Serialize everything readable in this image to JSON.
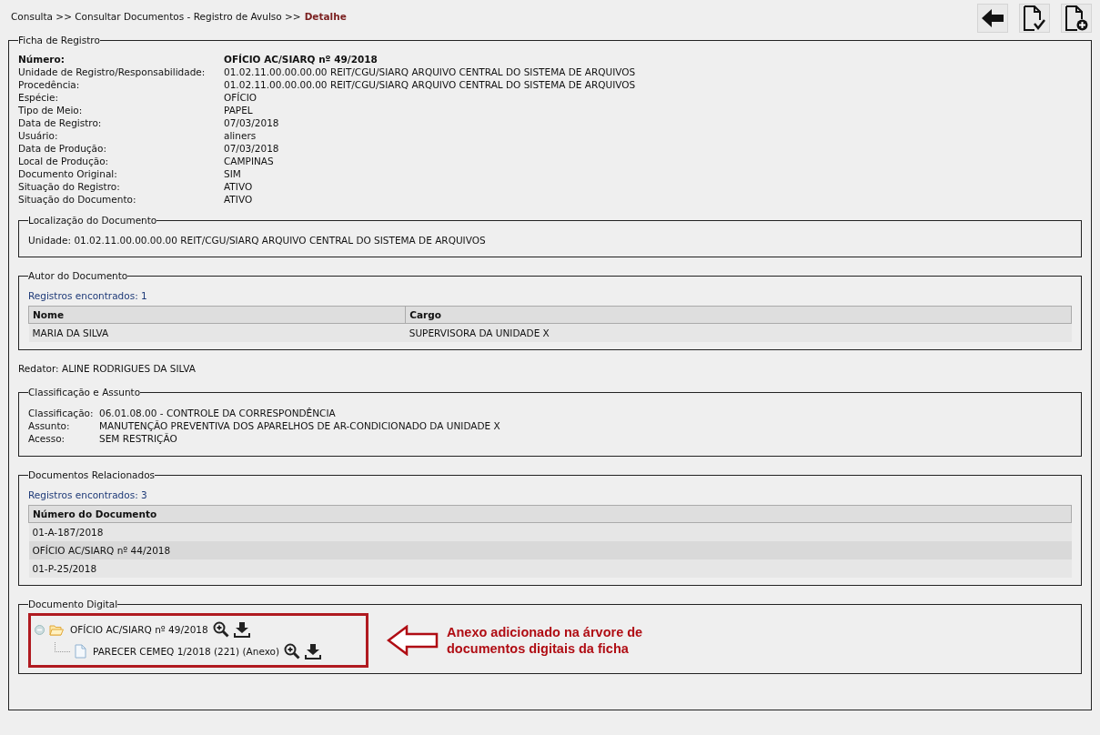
{
  "breadcrumb": {
    "path": "Consulta >> Consultar Documentos - Registro de Avulso >>",
    "current": "Detalhe"
  },
  "ficha": {
    "legend": "Ficha de Registro",
    "fields": [
      {
        "label": "Número:",
        "value": "OFÍCIO AC/SIARQ nº 49/2018",
        "bold": true
      },
      {
        "label": "Unidade de Registro/Responsabilidade:",
        "value": "01.02.11.00.00.00.00 REIT/CGU/SIARQ ARQUIVO CENTRAL DO SISTEMA DE ARQUIVOS",
        "bold": false
      },
      {
        "label": "Procedência:",
        "value": "01.02.11.00.00.00.00 REIT/CGU/SIARQ ARQUIVO CENTRAL DO SISTEMA DE ARQUIVOS",
        "bold": false
      },
      {
        "label": "Espécie:",
        "value": "OFÍCIO",
        "bold": false
      },
      {
        "label": "Tipo de Meio:",
        "value": "PAPEL",
        "bold": false
      },
      {
        "label": "Data de Registro:",
        "value": "07/03/2018",
        "bold": false
      },
      {
        "label": "Usuário:",
        "value": "aliners",
        "bold": false
      },
      {
        "label": "Data de Produção:",
        "value": "07/03/2018",
        "bold": false
      },
      {
        "label": "Local de Produção:",
        "value": "CAMPINAS",
        "bold": false
      },
      {
        "label": "Documento Original:",
        "value": "SIM",
        "bold": false
      },
      {
        "label": "Situação do Registro:",
        "value": "ATIVO",
        "bold": false
      },
      {
        "label": "Situação do Documento:",
        "value": "ATIVO",
        "bold": false
      }
    ]
  },
  "localizacao": {
    "legend": "Localização do Documento",
    "label": "Unidade:",
    "value": "01.02.11.00.00.00.00 REIT/CGU/SIARQ ARQUIVO CENTRAL DO SISTEMA DE ARQUIVOS"
  },
  "autor": {
    "legend": "Autor do Documento",
    "count": "Registros encontrados: 1",
    "columns": [
      "Nome",
      "Cargo"
    ],
    "rows": [
      [
        "MARIA DA SILVA",
        "SUPERVISORA DA UNIDADE X"
      ]
    ]
  },
  "redator": {
    "label": "Redator:",
    "value": "ALINE RODRIGUES DA SILVA"
  },
  "classificacao": {
    "legend": "Classificação e Assunto",
    "fields": [
      {
        "label": "Classificação:",
        "value": "06.01.08.00 - CONTROLE DA CORRESPONDÊNCIA"
      },
      {
        "label": "Assunto:",
        "value": "MANUTENÇÃO PREVENTIVA DOS APARELHOS DE AR-CONDICIONADO DA UNIDADE X"
      },
      {
        "label": "Acesso:",
        "value": "SEM RESTRIÇÃO"
      }
    ]
  },
  "relacionados": {
    "legend": "Documentos Relacionados",
    "count": "Registros encontrados: 3",
    "columns": [
      "Número do Documento"
    ],
    "rows": [
      [
        "01-A-187/2018"
      ],
      [
        "OFÍCIO AC/SIARQ nº 44/2018"
      ],
      [
        "01-P-25/2018"
      ]
    ]
  },
  "digital": {
    "legend": "Documento Digital",
    "tree": [
      {
        "kind": "folder",
        "label": "OFÍCIO AC/SIARQ nº 49/2018",
        "expanded": true,
        "children": [
          {
            "kind": "file",
            "label": "PARECER CEMEQ 1/2018 (221) (Anexo)"
          }
        ]
      }
    ],
    "callout": "Anexo adicionado na árvore de documentos digitais da ficha"
  }
}
